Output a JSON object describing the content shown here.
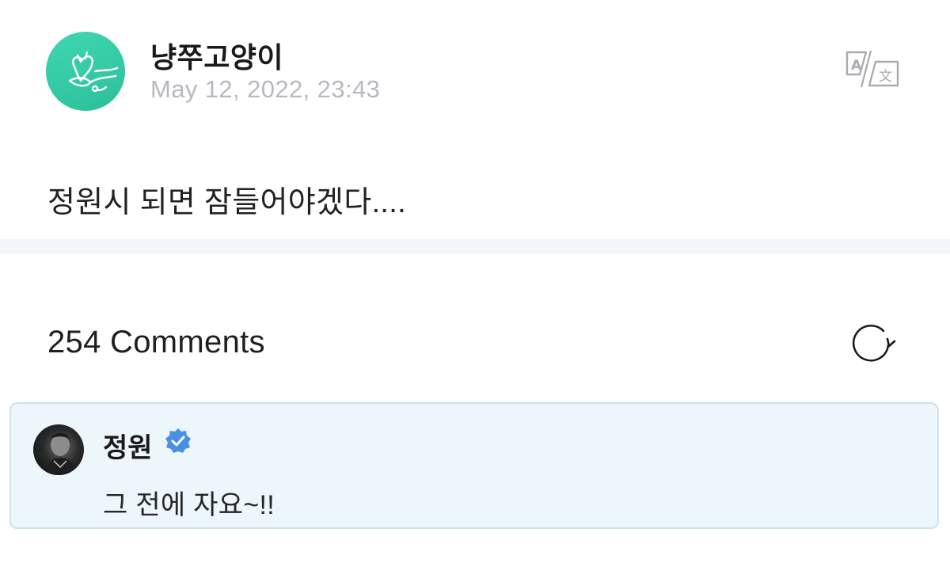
{
  "post": {
    "author_name": "냥쭈고양이",
    "date": "May 12, 2022, 23:43",
    "body": "정원시 되면 잠들어야겠다....",
    "avatar_icon": "heart-doodle-avatar",
    "translate_icon": "translate-icon"
  },
  "comments": {
    "count_label": "254 Comments",
    "refresh_icon": "refresh-icon",
    "items": [
      {
        "author_name": "정원",
        "verified": true,
        "text": "그 전에 자요~!!"
      }
    ]
  },
  "colors": {
    "avatar_green": "#34c9a4",
    "date_gray": "#b7b9bf",
    "comment_bg": "#ecf6fb",
    "comment_border": "#cfe3ec",
    "verified_blue": "#4a90e2",
    "divider": "#f4f5f7"
  }
}
